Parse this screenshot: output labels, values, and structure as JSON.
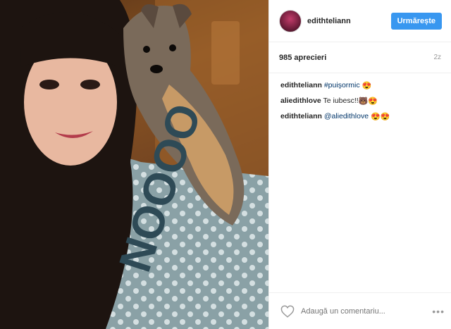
{
  "post": {
    "username": "edithteliann",
    "follow_label": "Urmărește",
    "likes_text": "985 aprecieri",
    "time_ago": "2z"
  },
  "comments": [
    {
      "user": "edithteliann",
      "text": "",
      "tag": "#puişormic",
      "emoji": "😍"
    },
    {
      "user": "aliedithlove",
      "text": "Te iubesc!!",
      "tag": "",
      "emoji": "🐻😍"
    },
    {
      "user": "edithteliann",
      "text": "",
      "tag": "@aliedithlove",
      "emoji": "😍😍"
    }
  ],
  "footer": {
    "add_comment_placeholder": "Adaugă un comentariu...",
    "more_label": "•••"
  },
  "photo": {
    "shirt_text": "NOOOO"
  },
  "icons": {
    "like": "heart-icon",
    "more": "more-options-icon"
  },
  "colors": {
    "follow_button": "#3897f0",
    "hashtag": "#003569"
  }
}
